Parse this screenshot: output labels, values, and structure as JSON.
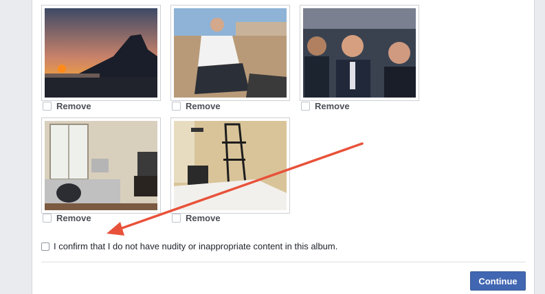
{
  "photos": [
    {
      "remove_label": "Remove",
      "subject": "sunset over mountain and beach"
    },
    {
      "remove_label": "Remove",
      "subject": "man sitting on beach"
    },
    {
      "remove_label": "Remove",
      "subject": "group of friends selfie"
    },
    {
      "remove_label": "Remove",
      "subject": "apartment room with desk"
    },
    {
      "remove_label": "Remove",
      "subject": "bedroom with shelf"
    }
  ],
  "confirm": {
    "label": "I confirm that I do not have nudity or inappropriate content in this album."
  },
  "footer": {
    "continue_label": "Continue"
  },
  "colors": {
    "accent": "#4267b2",
    "arrow": "#e8523a"
  }
}
